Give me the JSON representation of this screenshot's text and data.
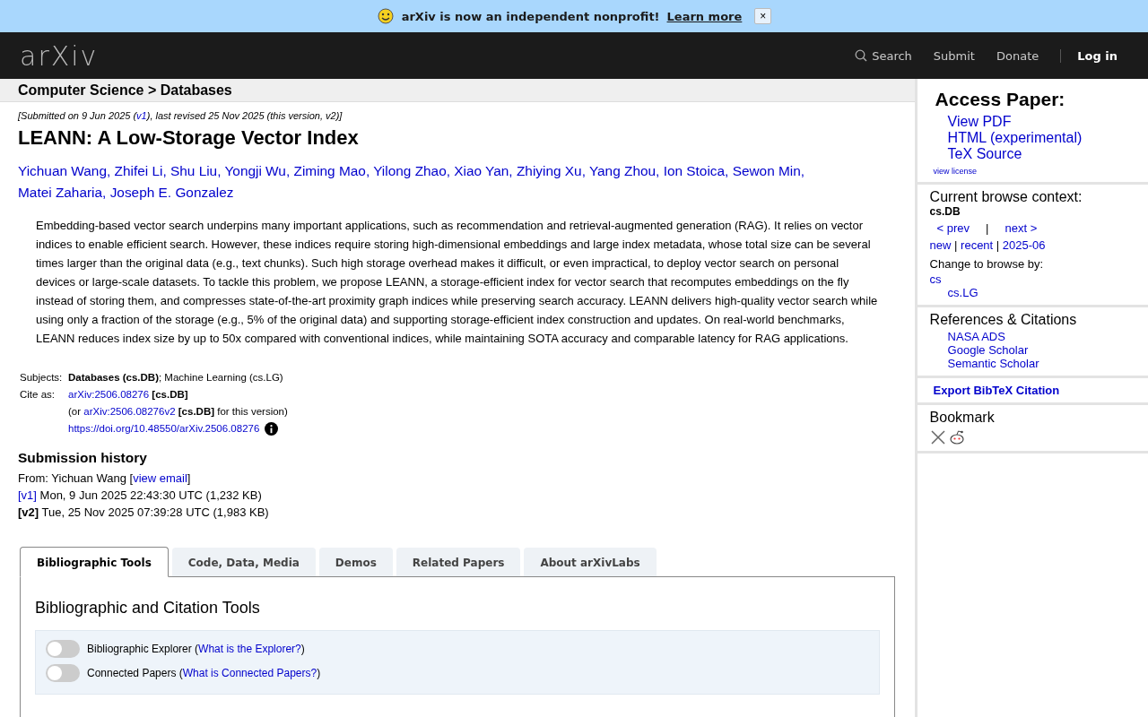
{
  "banner": {
    "text": "arXiv is now an independent nonprofit!",
    "link": "Learn more",
    "close": "×"
  },
  "header": {
    "logo": "arXiv",
    "nav": [
      {
        "label": "Search",
        "kind": "search"
      },
      {
        "label": "Submit",
        "kind": "link"
      },
      {
        "label": "Donate",
        "kind": "link"
      },
      {
        "label": "Log in",
        "kind": "login"
      }
    ]
  },
  "breadcrumb": "Computer Science > Databases",
  "dateline": [
    {
      "kind": "text",
      "t": "[Submitted on 9 Jun 2025 ("
    },
    {
      "kind": "link",
      "t": "v1"
    },
    {
      "kind": "text",
      "t": "), last revised 25 Nov 2025 (this version, v2)]"
    }
  ],
  "title": "LEANN: A Low-Storage Vector Index",
  "authors": [
    "Yichuan Wang",
    "Zhifei Li",
    "Shu Liu",
    "Yongji Wu",
    "Ziming Mao",
    "Yilong Zhao",
    "Xiao Yan",
    "Zhiying Xu",
    "Yang Zhou",
    "Ion Stoica",
    "Sewon Min",
    "Matei Zaharia",
    "Joseph E. Gonzalez"
  ],
  "author_separator": ", ",
  "abstract": "Embedding-based vector search underpins many important applications, such as recommendation and retrieval-augmented generation (RAG). It relies on vector indices to enable efficient search. However, these indices require storing high-dimensional embeddings and large index metadata, whose total size can be several times larger than the original data (e.g., text chunks). Such high storage overhead makes it difficult, or even impractical, to deploy vector search on personal devices or large-scale datasets. To tackle this problem, we propose LEANN, a storage-efficient index for vector search that recomputes embeddings on the fly instead of storing them, and compresses state-of-the-art proximity graph indices while preserving search accuracy. LEANN delivers high-quality vector search while using only a fraction of the storage (e.g., 5% of the original data) and supporting storage-efficient index construction and updates. On real-world benchmarks, LEANN reduces index size by up to 50x compared with conventional indices, while maintaining SOTA accuracy and comparable latency for RAG applications.",
  "meta": [
    {
      "label": "Subjects:",
      "lines": [
        [
          {
            "kind": "bold",
            "t": "Databases (cs.DB)"
          },
          {
            "kind": "text",
            "t": "; Machine Learning (cs.LG)"
          }
        ]
      ]
    },
    {
      "label": "Cite as:",
      "lines": [
        [
          {
            "kind": "link",
            "t": "arXiv:2506.08276"
          },
          {
            "kind": "bold",
            "t": " [cs.DB]"
          }
        ],
        [
          {
            "kind": "text",
            "t": "(or "
          },
          {
            "kind": "link",
            "t": "arXiv:2506.08276v2"
          },
          {
            "kind": "bold",
            "t": " [cs.DB]"
          },
          {
            "kind": "text",
            "t": " for this version)"
          }
        ],
        [
          {
            "kind": "link",
            "t": "https://doi.org/10.48550/arXiv.2506.08276"
          },
          {
            "kind": "info"
          }
        ]
      ]
    }
  ],
  "history": {
    "heading": "Submission history",
    "lines": [
      [
        {
          "kind": "text",
          "t": "From: Yichuan Wang ["
        },
        {
          "kind": "link",
          "t": "view email"
        },
        {
          "kind": "text",
          "t": "]"
        }
      ],
      [
        {
          "kind": "link",
          "t": "[v1]"
        },
        {
          "kind": "text",
          "t": " Mon, 9 Jun 2025 22:43:30 UTC (1,232 KB)"
        }
      ],
      [
        {
          "kind": "bold",
          "t": "[v2]"
        },
        {
          "kind": "text",
          "t": " Tue, 25 Nov 2025 07:39:28 UTC (1,983 KB)"
        }
      ]
    ]
  },
  "tabs": [
    {
      "label": "Bibliographic Tools",
      "selected": true
    },
    {
      "label": "Code, Data, Media",
      "selected": false
    },
    {
      "label": "Demos",
      "selected": false
    },
    {
      "label": "Related Papers",
      "selected": false
    },
    {
      "label": "About arXivLabs",
      "selected": false
    }
  ],
  "panel": {
    "heading": "Bibliographic and Citation Tools",
    "toggles": [
      {
        "label": "Bibliographic Explorer (",
        "link": "What is the Explorer?",
        "after": ")",
        "on": false
      },
      {
        "label": "Connected Papers (",
        "link": "What is Connected Papers?",
        "after": ")",
        "on": false
      }
    ]
  },
  "sidebar": {
    "access": {
      "heading": "Access Paper:",
      "links": [
        "View PDF",
        "HTML (experimental)",
        "TeX Source"
      ],
      "license": "view license"
    },
    "context": {
      "heading": "Current browse context:",
      "current": "cs.DB",
      "prev": "< prev",
      "sep": "|",
      "next": "next >",
      "periods": [
        "new",
        "recent",
        "2025-06"
      ],
      "period_separator": " | ",
      "change": "Change to browse by:",
      "browse": [
        {
          "label": "cs",
          "children": [
            {
              "label": "cs.LG"
            }
          ]
        }
      ]
    },
    "refs": {
      "heading": "References & Citations",
      "links": [
        "NASA ADS",
        "Google Scholar",
        "Semantic Scholar"
      ]
    },
    "export": "Export BibTeX Citation",
    "bookmark": "Bookmark"
  }
}
